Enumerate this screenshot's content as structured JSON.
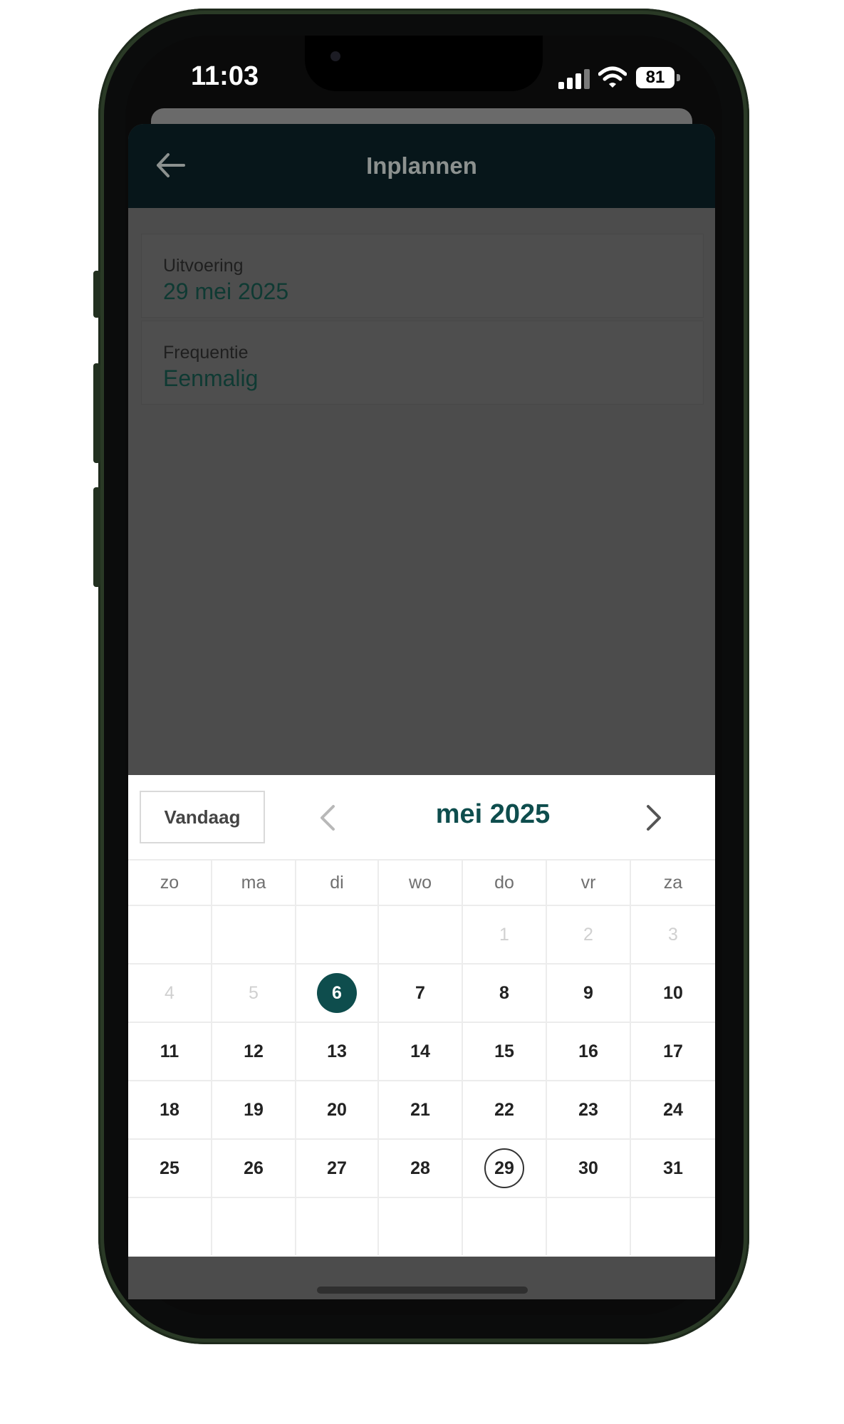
{
  "status_bar": {
    "time": "11:03",
    "battery": "81"
  },
  "header": {
    "title": "Inplannen",
    "back_icon": "arrow-left-icon"
  },
  "fields": [
    {
      "label": "Uitvoering",
      "value": "29 mei 2025"
    },
    {
      "label": "Frequentie",
      "value": "Eenmalig"
    }
  ],
  "picker": {
    "today_label": "Vandaag",
    "month_label": "mei 2025",
    "prev_icon": "chevron-left-icon",
    "next_icon": "chevron-right-icon",
    "weekdays": [
      "zo",
      "ma",
      "di",
      "wo",
      "do",
      "vr",
      "za"
    ],
    "weeks": [
      [
        "",
        "",
        "",
        "",
        "1",
        "2",
        "3"
      ],
      [
        "4",
        "5",
        "6",
        "7",
        "8",
        "9",
        "10"
      ],
      [
        "11",
        "12",
        "13",
        "14",
        "15",
        "16",
        "17"
      ],
      [
        "18",
        "19",
        "20",
        "21",
        "22",
        "23",
        "24"
      ],
      [
        "25",
        "26",
        "27",
        "28",
        "29",
        "30",
        "31"
      ],
      [
        "",
        "",
        "",
        "",
        "",
        "",
        ""
      ]
    ],
    "disabled_days": [
      "1",
      "2",
      "3",
      "4",
      "5"
    ],
    "selected_day": "6",
    "ringed_day": "29"
  },
  "colors": {
    "accent": "#0e4d4d",
    "header_bg": "#07161a",
    "overlay": "#4c4c4c"
  }
}
